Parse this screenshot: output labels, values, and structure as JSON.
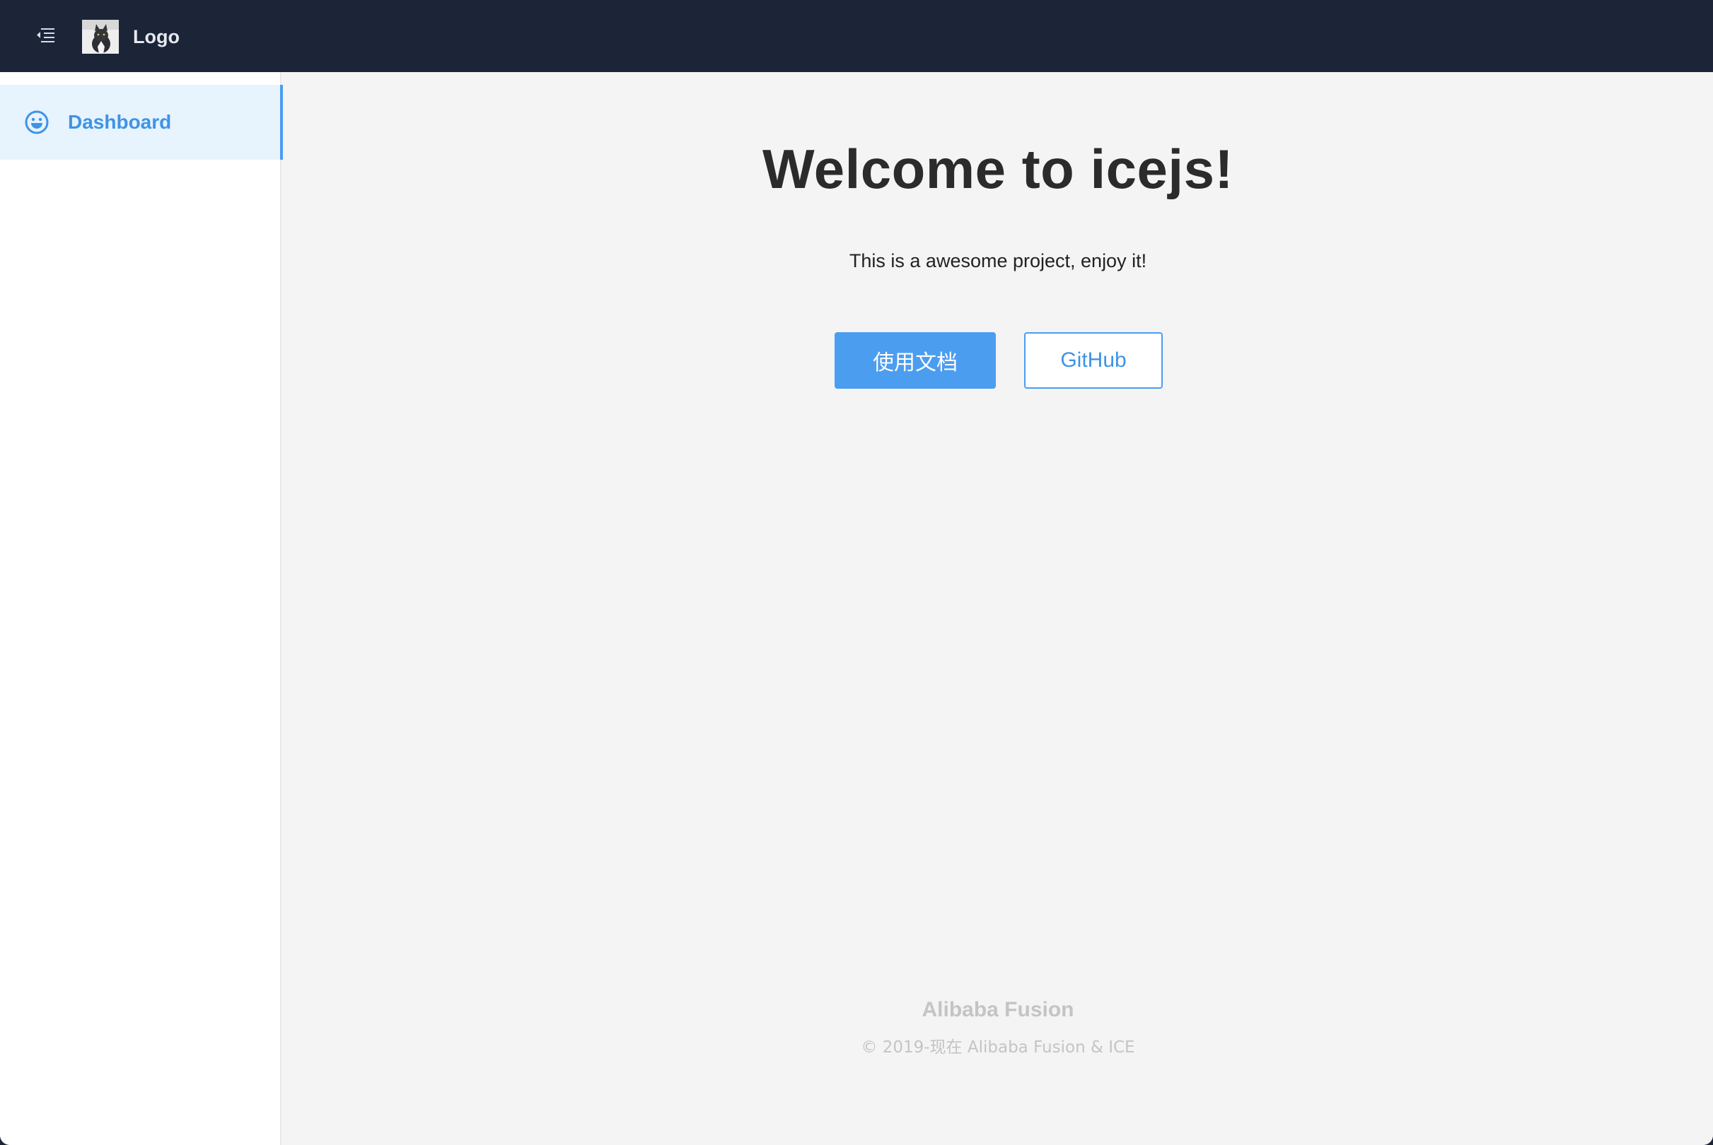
{
  "header": {
    "menu_icon": "menu-fold-icon",
    "logo_text": "Logo",
    "logo_image": "cat-logo-image"
  },
  "sidebar": {
    "items": [
      {
        "label": "Dashboard",
        "icon": "smile-icon",
        "active": true
      }
    ]
  },
  "main": {
    "title": "Welcome to icejs!",
    "subtitle": "This is a awesome project, enjoy it!",
    "primary_button": "使用文档",
    "secondary_button": "GitHub"
  },
  "footer": {
    "title": "Alibaba Fusion",
    "copyright": "© 2019-现在 Alibaba Fusion & ICE"
  },
  "colors": {
    "header_bg": "#1c2538",
    "accent": "#4b9df0",
    "active_nav_bg": "#e7f3fd",
    "content_bg": "#f4f4f5"
  }
}
